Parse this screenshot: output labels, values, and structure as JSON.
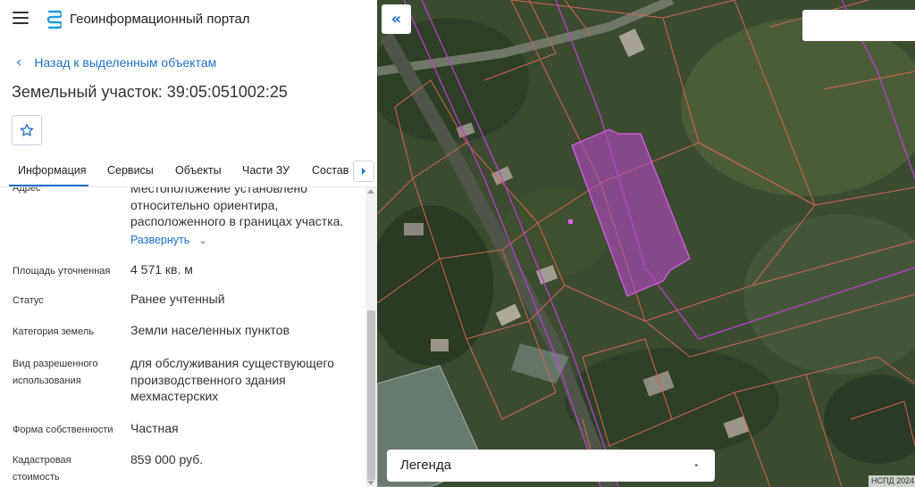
{
  "header": {
    "app_title": "Геоинформационный портал"
  },
  "back_link": "Назад к выделенным объектам",
  "page_title": "Земельный участок: 39:05:051002:25",
  "tabs": [
    {
      "label": "Информация",
      "active": true
    },
    {
      "label": "Сервисы",
      "active": false
    },
    {
      "label": "Объекты",
      "active": false
    },
    {
      "label": "Части ЗУ",
      "active": false
    },
    {
      "label": "Состав",
      "active": false
    }
  ],
  "details": {
    "address": {
      "label": "Адрес",
      "value": "Местоположение установлено относительно ориентира, расположенного в границах участка.",
      "expand_label": "Развернуть"
    },
    "area": {
      "label": "Площадь уточненная",
      "value": "4 571 кв. м"
    },
    "status": {
      "label": "Статус",
      "value": "Ранее учтенный"
    },
    "category": {
      "label": "Категория земель",
      "value": "Земли населенных пунктов"
    },
    "permitted_use": {
      "label": "Вид разрешенного использования",
      "value": "для обслуживания существующего производственного здания мехмастерских"
    },
    "ownership": {
      "label": "Форма собственности",
      "value": "Частная"
    },
    "cadastral_value": {
      "label": "Кадастровая стоимость",
      "value": "859 000 руб."
    }
  },
  "map": {
    "legend_label": "Легенда",
    "attribution": "НСПД 2024",
    "colors": {
      "parcel_border": "#d9634a",
      "zone_border": "#c23bd6",
      "selected_fill": "#b94ac8",
      "accent": "#1e6fc9"
    }
  },
  "icons": {
    "menu": "menu-icon",
    "logo": "logo-icon",
    "back": "chevron-left-icon",
    "favorite": "star-icon",
    "tabs_next": "chevron-right-icon",
    "collapse": "double-chevron-left-icon",
    "legend_toggle": "unfold-icon"
  }
}
